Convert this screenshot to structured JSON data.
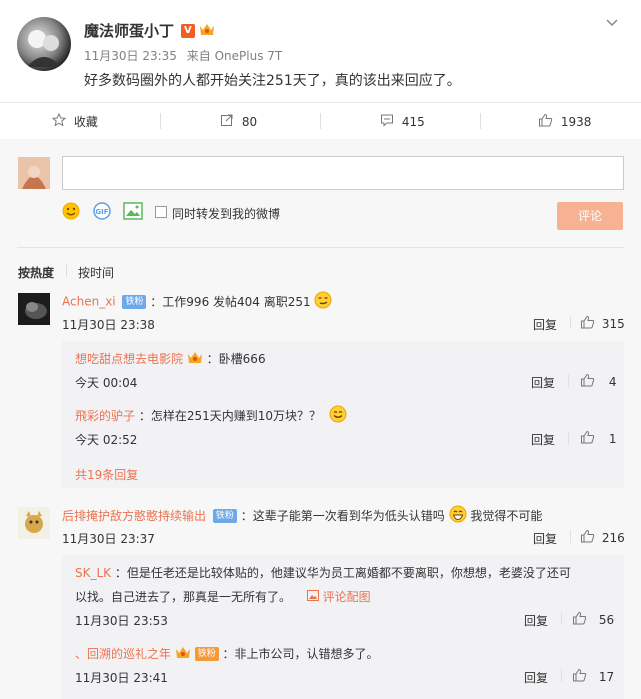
{
  "post": {
    "author": "魔法师蛋小丁",
    "time": "11月30日 23:35",
    "source": "来自 OnePlus 7T",
    "text": "好多数码圈外的人都开始关注251天了，真的该出来回应了。"
  },
  "actions": {
    "collect": "收藏",
    "repost": "80",
    "comment": "415",
    "like": "1938"
  },
  "composer": {
    "placeholder": "",
    "also_post_label": "同时转发到我的微博",
    "submit_label": "评论"
  },
  "sort": {
    "hot": "按热度",
    "time": "按时间"
  },
  "comments": [
    {
      "user": "Achen_xi",
      "badge": "铁粉",
      "text": "：工作996 发帖404 离职251",
      "time": "11月30日 23:38",
      "reply_label": "回复",
      "likes": "315",
      "replies": [
        {
          "user": "想吃甜点想去电影院",
          "text": "：卧槽666",
          "time": "今天 00:04",
          "reply_label": "回复",
          "likes": "4"
        },
        {
          "user": "飛彩的驴子",
          "text": "：怎样在251天内赚到10万块？？",
          "time": "今天 02:52",
          "reply_label": "回复",
          "likes": "1"
        }
      ],
      "more": "共19条回复"
    },
    {
      "user": "后排掩护敌方憨憨持续输出",
      "badge": "铁粉",
      "text": "：这辈子能第一次看到华为低头认错吗",
      "text2": "我觉得不可能",
      "time": "11月30日 23:37",
      "reply_label": "回复",
      "likes": "216",
      "replies": [
        {
          "user": "SK_LK",
          "text": "：但是任老还是比较体贴的，他建议华为员工离婚都不要离职，你想想，老婆没了还可",
          "text_line2": "以找。自己进去了，那真是一无所有了。",
          "pic_label": "评论配图",
          "time": "11月30日 23:53",
          "reply_label": "回复",
          "likes": "56"
        },
        {
          "user": "回溯的巡礼之年",
          "badge": "铁粉",
          "text": "：非上市公司，认错想多了。",
          "time": "11月30日 23:41",
          "reply_label": "回复",
          "likes": "17"
        }
      ]
    }
  ]
}
